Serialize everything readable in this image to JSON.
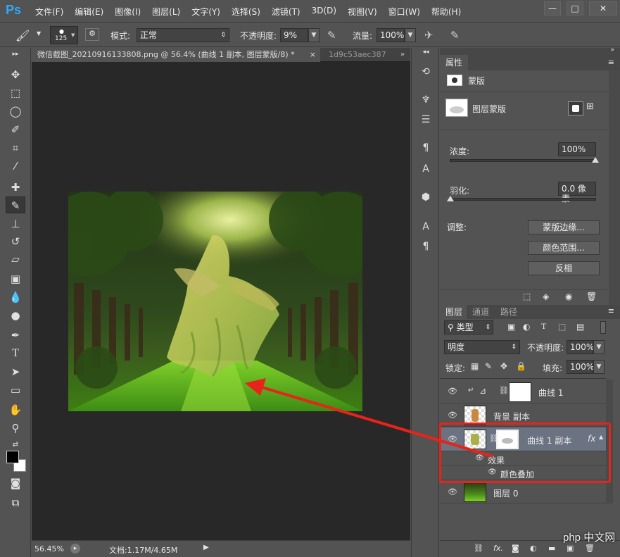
{
  "app": {
    "logo": "Ps"
  },
  "menu": [
    "文件(F)",
    "编辑(E)",
    "图像(I)",
    "图层(L)",
    "文字(Y)",
    "选择(S)",
    "滤镜(T)",
    "3D(D)",
    "视图(V)",
    "窗口(W)",
    "帮助(H)"
  ],
  "window_controls": [
    "—",
    "□",
    "✕"
  ],
  "options": {
    "brush_size": "125",
    "mode_label": "模式:",
    "mode_value": "正常",
    "opacity_label": "不透明度:",
    "opacity_value": "9%",
    "flow_label": "流量:",
    "flow_value": "100%"
  },
  "document": {
    "tab1": "微信截图_20210916133808.png @ 56.4% (曲线 1 副本, 图层蒙版/8) *",
    "tab2": "1d9c53aec387",
    "zoom": "56.45%",
    "doc_info": "文档:1.17M/4.65M"
  },
  "properties": {
    "tab": "属性",
    "mask_title": "蒙版",
    "layer_mask_label": "图层蒙版",
    "density_label": "浓度:",
    "density_value": "100%",
    "density_fraction": 1.0,
    "feather_label": "羽化:",
    "feather_value": "0.0 像素",
    "feather_fraction": 0.0,
    "adjust_label": "调整:",
    "btn_edge": "蒙版边缘...",
    "btn_range": "颜色范围...",
    "btn_invert": "反相"
  },
  "layers_panel": {
    "tabs": [
      "图层",
      "通道",
      "路径"
    ],
    "filter_kind": "类型",
    "blend_mode": "明度",
    "opacity_label": "不透明度:",
    "opacity_value": "100%",
    "lock_label": "锁定:",
    "fill_label": "填充:",
    "fill_value": "100%",
    "layers": [
      {
        "name": "曲线 1"
      },
      {
        "name": "背景 副本"
      },
      {
        "name": "曲线 1 副本",
        "fx": "fx"
      },
      {
        "name": "图层 0"
      }
    ],
    "effects_label": "效果",
    "effect_item": "颜色叠加"
  },
  "watermark": "php 中文网",
  "colors": {
    "annotation_red": "#e8231a",
    "accent_blue": "#31a8ff"
  }
}
